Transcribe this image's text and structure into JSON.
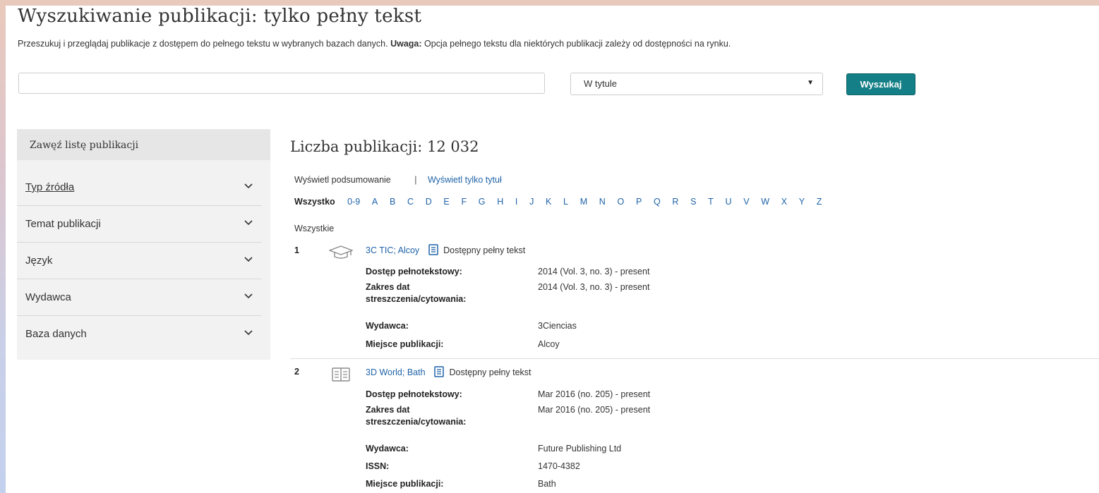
{
  "page": {
    "title": "Wyszukiwanie publikacji: tylko pełny tekst",
    "intro_text": "Przeszukuj i przeglądaj publikacje z dostępem do pełnego tekstu w wybranych bazach danych.",
    "intro_note_label": "Uwaga:",
    "intro_note_text": "Opcja pełnego tekstu dla niektórych publikacji zależy od dostępności na rynku."
  },
  "search": {
    "query_value": "",
    "scope_selected": "W tytule",
    "button_label": "Wyszukaj"
  },
  "sidebar": {
    "heading": "Zawęź listę publikacji",
    "facets": [
      {
        "label": "Typ źródła"
      },
      {
        "label": "Temat publikacji"
      },
      {
        "label": "Język"
      },
      {
        "label": "Wydawca"
      },
      {
        "label": "Baza danych"
      }
    ]
  },
  "results": {
    "count_label": "Liczba publikacji: 12 032",
    "view_summary": "Wyświetl podsumowanie",
    "view_separator": "|",
    "view_title_only": "Wyświetl tylko tytuł",
    "alpha_all": "Wszystko",
    "alpha_letters": [
      "0-9",
      "A",
      "B",
      "C",
      "D",
      "E",
      "F",
      "G",
      "H",
      "I",
      "J",
      "K",
      "L",
      "M",
      "N",
      "O",
      "P",
      "Q",
      "R",
      "S",
      "T",
      "U",
      "V",
      "W",
      "X",
      "Y",
      "Z"
    ],
    "group_label": "Wszystkie",
    "full_text_label": "Dostępny pełny tekst",
    "records": [
      {
        "number": "1",
        "icon": "graduation-cap-icon",
        "title": "3C TIC; Alcoy",
        "fields": [
          {
            "key": "Dostęp pełnotekstowy:",
            "value": "2014 (Vol. 3, no. 3) - present"
          },
          {
            "key": "Zakres dat",
            "key2": "streszczenia/cytowania:",
            "value": "2014 (Vol. 3, no. 3) - present"
          },
          {
            "key": "Wydawca:",
            "value": "3Ciencias"
          },
          {
            "key": "Miejsce publikacji:",
            "value": "Alcoy"
          }
        ]
      },
      {
        "number": "2",
        "icon": "magazine-icon",
        "title": "3D World; Bath",
        "fields": [
          {
            "key": "Dostęp pełnotekstowy:",
            "value": "Mar 2016 (no. 205) - present"
          },
          {
            "key": "Zakres dat",
            "key2": "streszczenia/cytowania:",
            "value": "Mar 2016 (no. 205) - present"
          },
          {
            "key": "Wydawca:",
            "value": "Future Publishing Ltd"
          },
          {
            "key": "ISSN:",
            "value": "1470-4382"
          },
          {
            "key": "Miejsce publikacji:",
            "value": "Bath"
          }
        ]
      }
    ]
  }
}
